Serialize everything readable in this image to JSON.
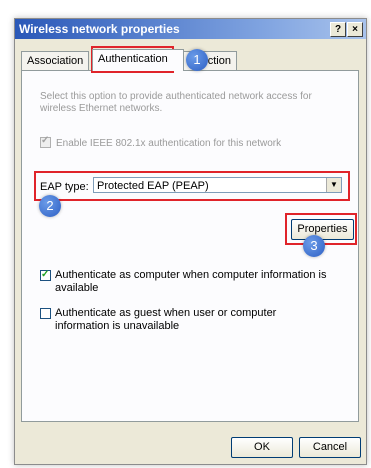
{
  "window": {
    "title": "Wireless network properties",
    "help_label": "?",
    "close_label": "×"
  },
  "tabs": [
    {
      "label": "Association"
    },
    {
      "label": "Authentication"
    },
    {
      "label": "ction"
    }
  ],
  "panel": {
    "description": "Select this option to provide authenticated network access for wireless Ethernet networks.",
    "enable_label": "Enable IEEE 802.1x authentication for this network",
    "eap_type_label": "EAP type:",
    "eap_type_value": "Protected EAP (PEAP)",
    "properties_label": "Properties",
    "auth_computer_label": "Authenticate as computer when computer information is available",
    "auth_guest_label": "Authenticate as guest when user or computer information is unavailable"
  },
  "footer": {
    "ok_label": "OK",
    "cancel_label": "Cancel"
  },
  "annotations": {
    "badge_1": "1",
    "badge_2": "2",
    "badge_3": "3",
    "highlight_color": "#e0242a",
    "badge_color": "#2d5fc4"
  },
  "state": {
    "enable_checked": true,
    "enable_disabled": true,
    "auth_computer_checked": true,
    "auth_guest_checked": false
  }
}
